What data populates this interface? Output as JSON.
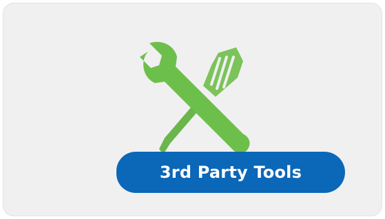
{
  "card": {
    "icon": "tools-icon",
    "label": "3rd Party Tools"
  },
  "colors": {
    "card_background": "#f0f0f1",
    "icon_green": "#6dbf4b",
    "pill_blue": "#0b67b8",
    "label_text": "#ffffff"
  }
}
